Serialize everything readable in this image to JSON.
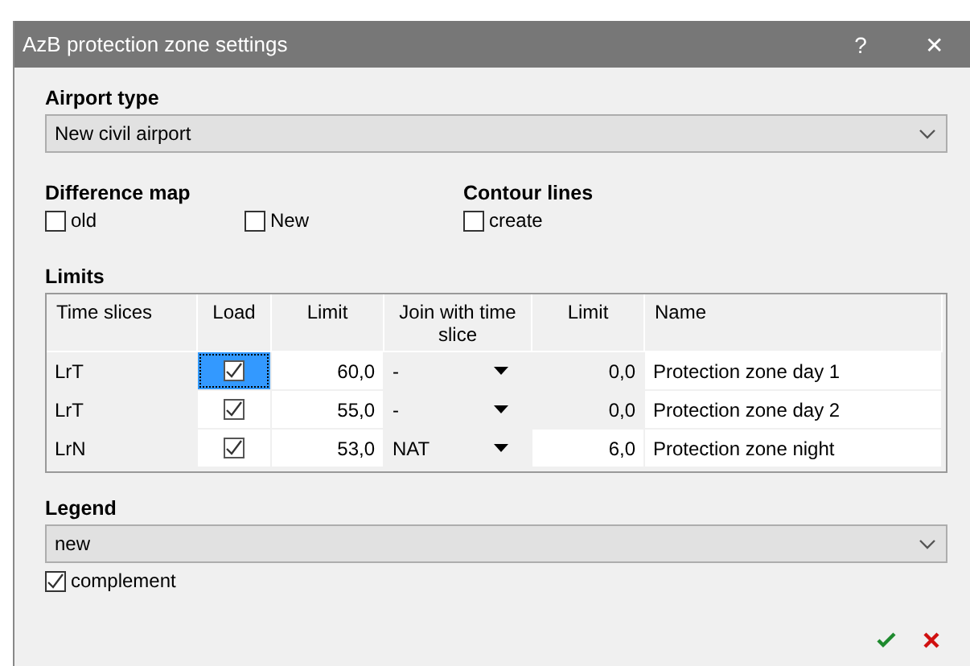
{
  "window": {
    "title": "AzB protection zone settings",
    "help": "?",
    "close": "✕"
  },
  "airport_type": {
    "label": "Airport type",
    "value": "New civil airport"
  },
  "difference_map": {
    "label": "Difference map",
    "options": [
      {
        "label": "old",
        "checked": false
      },
      {
        "label": "New",
        "checked": false
      }
    ]
  },
  "contour_lines": {
    "label": "Contour lines",
    "options": [
      {
        "label": "create",
        "checked": false
      }
    ]
  },
  "limits": {
    "label": "Limits",
    "columns": [
      "Time slices",
      "Load",
      "Limit",
      "Join with time slice",
      "Limit",
      "Name"
    ],
    "rows": [
      {
        "time_slice": "LrT",
        "load": true,
        "focused": true,
        "limit": "60,0",
        "join": "-",
        "join_limit": "0,0",
        "join_limit_editable": false,
        "name": "Protection zone day 1"
      },
      {
        "time_slice": "LrT",
        "load": true,
        "focused": false,
        "limit": "55,0",
        "join": "-",
        "join_limit": "0,0",
        "join_limit_editable": false,
        "name": "Protection zone day 2"
      },
      {
        "time_slice": "LrN",
        "load": true,
        "focused": false,
        "limit": "53,0",
        "join": "NAT",
        "join_limit": "6,0",
        "join_limit_editable": true,
        "name": "Protection zone night"
      }
    ]
  },
  "legend": {
    "label": "Legend",
    "value": "new",
    "complement": {
      "label": "complement",
      "checked": true
    }
  }
}
